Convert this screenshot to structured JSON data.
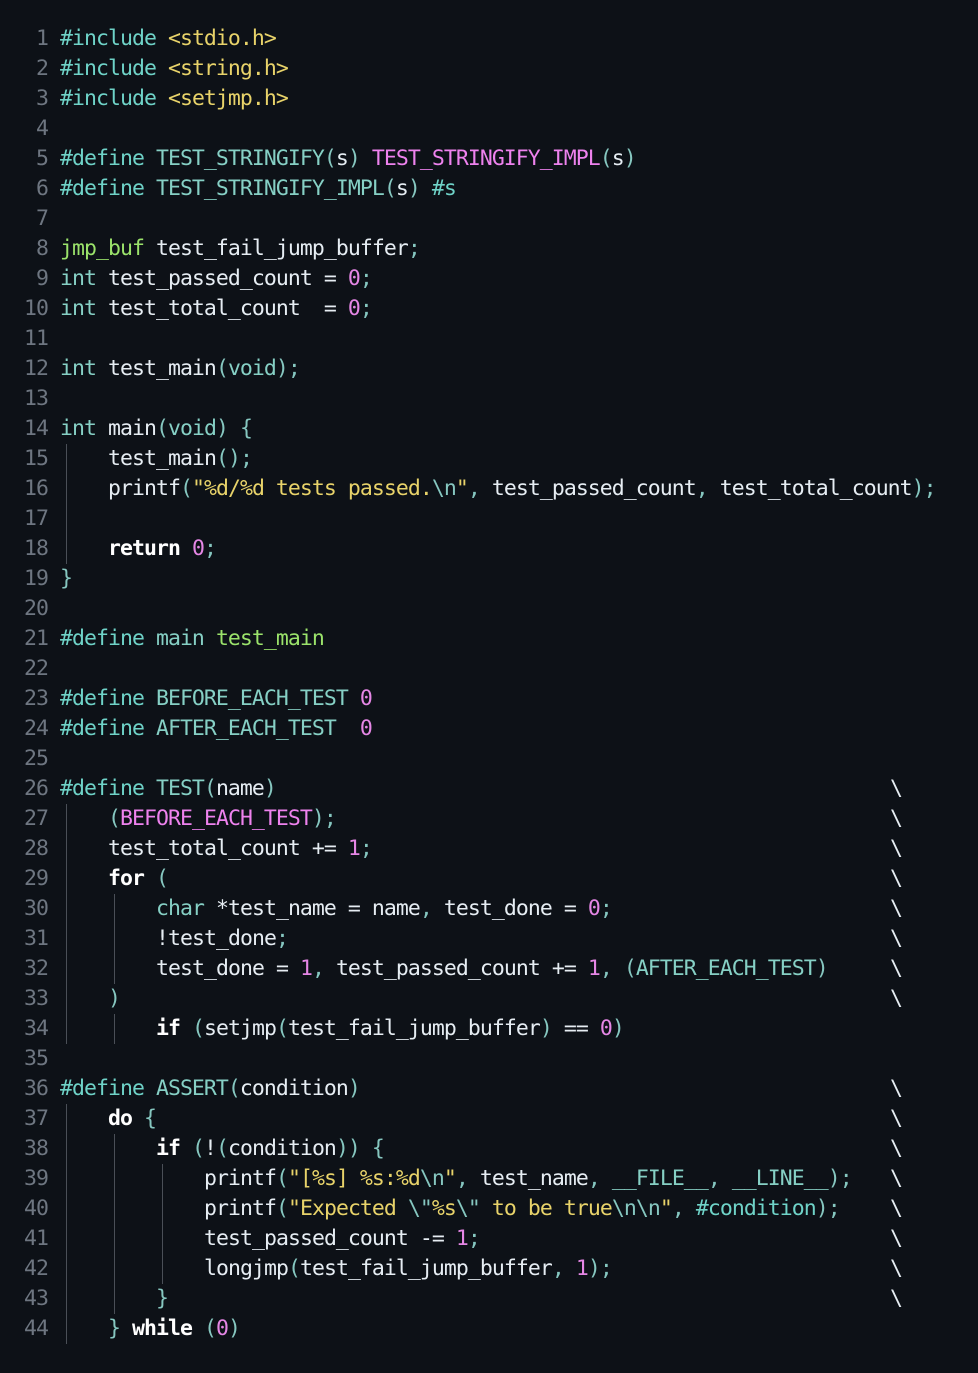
{
  "editor": {
    "lines": [
      {
        "n": "1",
        "indent": 0,
        "tokens": [
          [
            "pp",
            "#include "
          ],
          [
            "str",
            "<stdio.h>"
          ]
        ]
      },
      {
        "n": "2",
        "indent": 0,
        "tokens": [
          [
            "pp",
            "#include "
          ],
          [
            "str",
            "<string.h>"
          ]
        ]
      },
      {
        "n": "3",
        "indent": 0,
        "tokens": [
          [
            "pp",
            "#include "
          ],
          [
            "str",
            "<setjmp.h>"
          ]
        ]
      },
      {
        "n": "4",
        "indent": 0,
        "tokens": []
      },
      {
        "n": "5",
        "indent": 0,
        "tokens": [
          [
            "pp",
            "#define "
          ],
          [
            "ty",
            "TEST_STRINGIFY"
          ],
          [
            "p",
            "("
          ],
          [
            "id",
            "s"
          ],
          [
            "p",
            ") "
          ],
          [
            "mac",
            "TEST_STRINGIFY_IMPL"
          ],
          [
            "p",
            "("
          ],
          [
            "id",
            "s"
          ],
          [
            "p",
            ")"
          ]
        ]
      },
      {
        "n": "6",
        "indent": 0,
        "tokens": [
          [
            "pp",
            "#define "
          ],
          [
            "ty",
            "TEST_STRINGIFY_IMPL"
          ],
          [
            "p",
            "("
          ],
          [
            "id",
            "s"
          ],
          [
            "p",
            ") "
          ],
          [
            "pp",
            "#s"
          ]
        ]
      },
      {
        "n": "7",
        "indent": 0,
        "tokens": []
      },
      {
        "n": "8",
        "indent": 0,
        "tokens": [
          [
            "fn",
            "jmp_buf"
          ],
          [
            "id",
            " test_fail_jump_buffer"
          ],
          [
            "p",
            ";"
          ]
        ]
      },
      {
        "n": "9",
        "indent": 0,
        "tokens": [
          [
            "ty",
            "int"
          ],
          [
            "id",
            " test_passed_count = "
          ],
          [
            "num",
            "0"
          ],
          [
            "p",
            ";"
          ]
        ]
      },
      {
        "n": "10",
        "indent": 0,
        "tokens": [
          [
            "ty",
            "int"
          ],
          [
            "id",
            " test_total_count  = "
          ],
          [
            "num",
            "0"
          ],
          [
            "p",
            ";"
          ]
        ]
      },
      {
        "n": "11",
        "indent": 0,
        "tokens": []
      },
      {
        "n": "12",
        "indent": 0,
        "tokens": [
          [
            "ty",
            "int"
          ],
          [
            "id",
            " test_main"
          ],
          [
            "p",
            "("
          ],
          [
            "ty",
            "void"
          ],
          [
            "p",
            ");"
          ]
        ]
      },
      {
        "n": "13",
        "indent": 0,
        "tokens": []
      },
      {
        "n": "14",
        "indent": 0,
        "tokens": [
          [
            "ty",
            "int"
          ],
          [
            "id",
            " main"
          ],
          [
            "p",
            "("
          ],
          [
            "ty",
            "void"
          ],
          [
            "p",
            ") {"
          ]
        ]
      },
      {
        "n": "15",
        "indent": 1,
        "tokens": [
          [
            "id",
            "test_main"
          ],
          [
            "p",
            "();"
          ]
        ]
      },
      {
        "n": "16",
        "indent": 1,
        "tokens": [
          [
            "id",
            "printf"
          ],
          [
            "p",
            "("
          ],
          [
            "str",
            "\"%d/%d tests passed."
          ],
          [
            "p",
            "\\n"
          ],
          [
            "str",
            "\""
          ],
          [
            "p",
            ", "
          ],
          [
            "id",
            "test_passed_count"
          ],
          [
            "p",
            ", "
          ],
          [
            "id",
            "test_total_count"
          ],
          [
            "p",
            ");"
          ]
        ]
      },
      {
        "n": "17",
        "indent": 1,
        "tokens": []
      },
      {
        "n": "18",
        "indent": 1,
        "tokens": [
          [
            "kw",
            "return "
          ],
          [
            "num",
            "0"
          ],
          [
            "p",
            ";"
          ]
        ]
      },
      {
        "n": "19",
        "indent": 0,
        "tokens": [
          [
            "p",
            "}"
          ]
        ]
      },
      {
        "n": "20",
        "indent": 0,
        "tokens": []
      },
      {
        "n": "21",
        "indent": 0,
        "tokens": [
          [
            "pp",
            "#define "
          ],
          [
            "ty",
            "main "
          ],
          [
            "fn",
            "test_main"
          ]
        ]
      },
      {
        "n": "22",
        "indent": 0,
        "tokens": []
      },
      {
        "n": "23",
        "indent": 0,
        "tokens": [
          [
            "pp",
            "#define "
          ],
          [
            "ty",
            "BEFORE_EACH_TEST "
          ],
          [
            "num",
            "0"
          ]
        ]
      },
      {
        "n": "24",
        "indent": 0,
        "tokens": [
          [
            "pp",
            "#define "
          ],
          [
            "ty",
            "AFTER_EACH_TEST  "
          ],
          [
            "num",
            "0"
          ]
        ]
      },
      {
        "n": "25",
        "indent": 0,
        "tokens": []
      },
      {
        "n": "26",
        "indent": 0,
        "tokens": [
          [
            "pp",
            "#define "
          ],
          [
            "ty",
            "TEST"
          ],
          [
            "p",
            "("
          ],
          [
            "id",
            "name"
          ],
          [
            "p",
            ")"
          ]
        ],
        "cont": true
      },
      {
        "n": "27",
        "indent": 1,
        "tokens": [
          [
            "p",
            "("
          ],
          [
            "mac",
            "BEFORE_EACH_TEST"
          ],
          [
            "p",
            ");"
          ]
        ],
        "cont": true
      },
      {
        "n": "28",
        "indent": 1,
        "tokens": [
          [
            "id",
            "test_total_count += "
          ],
          [
            "num",
            "1"
          ],
          [
            "p",
            ";"
          ]
        ],
        "cont": true
      },
      {
        "n": "29",
        "indent": 1,
        "tokens": [
          [
            "kw",
            "for "
          ],
          [
            "p",
            "("
          ]
        ],
        "cont": true
      },
      {
        "n": "30",
        "indent": 2,
        "tokens": [
          [
            "ty",
            "char"
          ],
          [
            "id",
            " *test_name = name"
          ],
          [
            "p",
            ", "
          ],
          [
            "id",
            "test_done = "
          ],
          [
            "num",
            "0"
          ],
          [
            "p",
            ";"
          ]
        ],
        "cont": true
      },
      {
        "n": "31",
        "indent": 2,
        "tokens": [
          [
            "id",
            "!test_done"
          ],
          [
            "p",
            ";"
          ]
        ],
        "cont": true
      },
      {
        "n": "32",
        "indent": 2,
        "tokens": [
          [
            "id",
            "test_done = "
          ],
          [
            "num",
            "1"
          ],
          [
            "p",
            ", "
          ],
          [
            "id",
            "test_passed_count += "
          ],
          [
            "num",
            "1"
          ],
          [
            "p",
            ", ("
          ],
          [
            "ty",
            "AFTER_EACH_TEST"
          ],
          [
            "p",
            ")"
          ]
        ],
        "cont": true
      },
      {
        "n": "33",
        "indent": 1,
        "tokens": [
          [
            "p",
            ")"
          ]
        ],
        "cont": true
      },
      {
        "n": "34",
        "indent": 2,
        "tokens": [
          [
            "kw",
            "if "
          ],
          [
            "p",
            "("
          ],
          [
            "id",
            "setjmp"
          ],
          [
            "p",
            "("
          ],
          [
            "id",
            "test_fail_jump_buffer"
          ],
          [
            "p",
            ") "
          ],
          [
            "id",
            "== "
          ],
          [
            "num",
            "0"
          ],
          [
            "p",
            ")"
          ]
        ]
      },
      {
        "n": "35",
        "indent": 0,
        "tokens": []
      },
      {
        "n": "36",
        "indent": 0,
        "tokens": [
          [
            "pp",
            "#define "
          ],
          [
            "ty",
            "ASSERT"
          ],
          [
            "p",
            "("
          ],
          [
            "id",
            "condition"
          ],
          [
            "p",
            ")"
          ]
        ],
        "cont": true
      },
      {
        "n": "37",
        "indent": 1,
        "tokens": [
          [
            "kw",
            "do "
          ],
          [
            "p",
            "{"
          ]
        ],
        "cont": true
      },
      {
        "n": "38",
        "indent": 2,
        "tokens": [
          [
            "kw",
            "if "
          ],
          [
            "p",
            "("
          ],
          [
            "id",
            "!"
          ],
          [
            "p",
            "("
          ],
          [
            "id",
            "condition"
          ],
          [
            "p",
            ")) {"
          ]
        ],
        "cont": true
      },
      {
        "n": "39",
        "indent": 3,
        "tokens": [
          [
            "id",
            "printf"
          ],
          [
            "p",
            "("
          ],
          [
            "str",
            "\"[%s] %s:%d"
          ],
          [
            "p",
            "\\n"
          ],
          [
            "str",
            "\""
          ],
          [
            "p",
            ", "
          ],
          [
            "id",
            "test_name"
          ],
          [
            "p",
            ", "
          ],
          [
            "ty",
            "__FILE__"
          ],
          [
            "p",
            ", "
          ],
          [
            "ty",
            "__LINE__"
          ],
          [
            "p",
            ");"
          ]
        ],
        "cont": true
      },
      {
        "n": "40",
        "indent": 3,
        "tokens": [
          [
            "id",
            "printf"
          ],
          [
            "p",
            "("
          ],
          [
            "str",
            "\"Expected "
          ],
          [
            "p",
            "\\\""
          ],
          [
            "str",
            "%s"
          ],
          [
            "p",
            "\\\""
          ],
          [
            "str",
            " to be true"
          ],
          [
            "p",
            "\\n\\n"
          ],
          [
            "str",
            "\""
          ],
          [
            "p",
            ", "
          ],
          [
            "pp",
            "#condition"
          ],
          [
            "p",
            ");"
          ]
        ],
        "cont": true
      },
      {
        "n": "41",
        "indent": 3,
        "tokens": [
          [
            "id",
            "test_passed_count -= "
          ],
          [
            "num",
            "1"
          ],
          [
            "p",
            ";"
          ]
        ],
        "cont": true
      },
      {
        "n": "42",
        "indent": 3,
        "tokens": [
          [
            "id",
            "longjmp"
          ],
          [
            "p",
            "("
          ],
          [
            "id",
            "test_fail_jump_buffer"
          ],
          [
            "p",
            ", "
          ],
          [
            "num",
            "1"
          ],
          [
            "p",
            ");"
          ]
        ],
        "cont": true
      },
      {
        "n": "43",
        "indent": 2,
        "tokens": [
          [
            "p",
            "}"
          ]
        ],
        "cont": true
      },
      {
        "n": "44",
        "indent": 1,
        "tokens": [
          [
            "p",
            "} "
          ],
          [
            "kw",
            "while "
          ],
          [
            "p",
            "("
          ],
          [
            "num",
            "0"
          ],
          [
            "p",
            ")"
          ]
        ]
      }
    ],
    "guides": [
      {
        "level": 1,
        "from": "15",
        "to": "18"
      },
      {
        "level": 1,
        "from": "27",
        "to": "34"
      },
      {
        "level": 2,
        "from": "30",
        "to": "32"
      },
      {
        "level": 2,
        "from": "34",
        "to": "34"
      },
      {
        "level": 1,
        "from": "37",
        "to": "44"
      },
      {
        "level": 2,
        "from": "38",
        "to": "43"
      },
      {
        "level": 3,
        "from": "39",
        "to": "42"
      }
    ],
    "continuation_glyph": "\\"
  }
}
